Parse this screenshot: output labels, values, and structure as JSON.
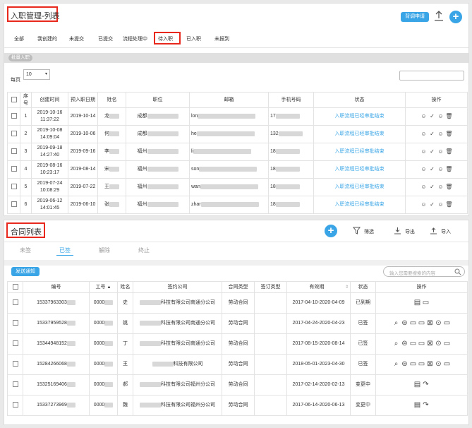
{
  "onboarding": {
    "title": "入职管理-列表",
    "apply_button": "背调申请",
    "tabs": [
      "全部",
      "我创建的",
      "未提交",
      "已提交",
      "流程处理中",
      "待入职",
      "已入职",
      "未报到"
    ],
    "active_tab": "待入职",
    "batch_button": "批量入职",
    "page_size_label": "每页",
    "page_size_value": "10",
    "columns": [
      "序号",
      "创建时间",
      "预入职日期",
      "姓名",
      "职位",
      "邮箱",
      "手机号码",
      "状态",
      "操作"
    ],
    "rows": [
      {
        "no": "1",
        "created": "2019-10-16 11:37:22",
        "date": "2019-10-14",
        "name": "龙",
        "position": "成都",
        "email": "lon",
        "phone": "17",
        "status": "入职流程已经审批结束"
      },
      {
        "no": "2",
        "created": "2019-10-08 14:09:04",
        "date": "2019-10-06",
        "name": "何",
        "position": "成都",
        "email": "he",
        "phone": "132",
        "status": "入职流程已经审批结束"
      },
      {
        "no": "3",
        "created": "2019-09-18 14:27:40",
        "date": "2019-09-16",
        "name": "李",
        "position": "福州",
        "email": "li",
        "phone": "18",
        "status": "入职流程已经审批结束"
      },
      {
        "no": "4",
        "created": "2019-08-16 10:23:17",
        "date": "2019-08-14",
        "name": "宋",
        "position": "福州",
        "email": "son",
        "phone": "18",
        "status": "入职流程已经审批结束"
      },
      {
        "no": "5",
        "created": "2019-07-24 10:08:29",
        "date": "2019-07-22",
        "name": "王",
        "position": "福州",
        "email": "wan",
        "phone": "18",
        "status": "入职流程已经审批结束"
      },
      {
        "no": "6",
        "created": "2019-06-12 14:01:45",
        "date": "2019-06-10",
        "name": "张",
        "position": "福州",
        "email": "zhar",
        "phone": "18",
        "status": "入职流程已经审批结束"
      }
    ]
  },
  "contracts": {
    "title": "合同列表",
    "filter_label": "筛选",
    "export_label": "导出",
    "import_label": "导入",
    "tabs": [
      "未签",
      "已签",
      "解除",
      "终止"
    ],
    "active_tab": "已签",
    "notify_button": "发送通知",
    "search_placeholder": "输入您需要搜索的内容",
    "columns": [
      "编号",
      "工号",
      "姓名",
      "签约公司",
      "合同类型",
      "签订类型",
      "有效期",
      "状态",
      "操作"
    ],
    "rows": [
      {
        "id": "15337963303",
        "emp": "0000",
        "name": "史",
        "company": "科技有限公司南通分公司",
        "type": "劳动合同",
        "period": "2017-04-10-2020-04-09",
        "status": "已到期",
        "icons": [
          "doc-icon",
          "file-icon"
        ]
      },
      {
        "id": "15337959528",
        "emp": "0000",
        "name": "姚",
        "company": "科技有限公司南通分公司",
        "type": "劳动合同",
        "period": "2017-04-24-2020-04-23",
        "status": "已签",
        "icons": [
          "search-icon",
          "swap-icon",
          "file-icon",
          "file-icon",
          "close-box-icon",
          "stop-icon",
          "file-icon"
        ]
      },
      {
        "id": "15344948152",
        "emp": "0000",
        "name": "丁",
        "company": "科技有限公司南通分公司",
        "type": "劳动合同",
        "period": "2017-08-15-2020-08-14",
        "status": "已签",
        "icons": [
          "search-icon",
          "swap-icon",
          "file-icon",
          "file-icon",
          "close-box-icon",
          "stop-icon",
          "file-icon"
        ]
      },
      {
        "id": "15284266068",
        "emp": "0000",
        "name": "王",
        "company": "科技有限公司",
        "type": "劳动合同",
        "period": "2018-05-01-2023-04-30",
        "status": "已签",
        "icons": [
          "search-icon",
          "swap-icon",
          "file-icon",
          "file-icon",
          "close-box-icon",
          "stop-icon",
          "file-icon"
        ]
      },
      {
        "id": "15325169406",
        "emp": "0000",
        "name": "郝",
        "company": "科技有限公司福州分公司",
        "type": "劳动合同",
        "period": "2017-02-14-2020-02-13",
        "status": "变更中",
        "icons": [
          "doc-icon",
          "share-icon"
        ]
      },
      {
        "id": "15337273969",
        "emp": "0000",
        "name": "魏",
        "company": "科技有限公司福州分公司",
        "type": "劳动合同",
        "period": "2017-06-14-2020-06-13",
        "status": "变更中",
        "icons": [
          "doc-icon",
          "share-icon"
        ]
      }
    ]
  }
}
